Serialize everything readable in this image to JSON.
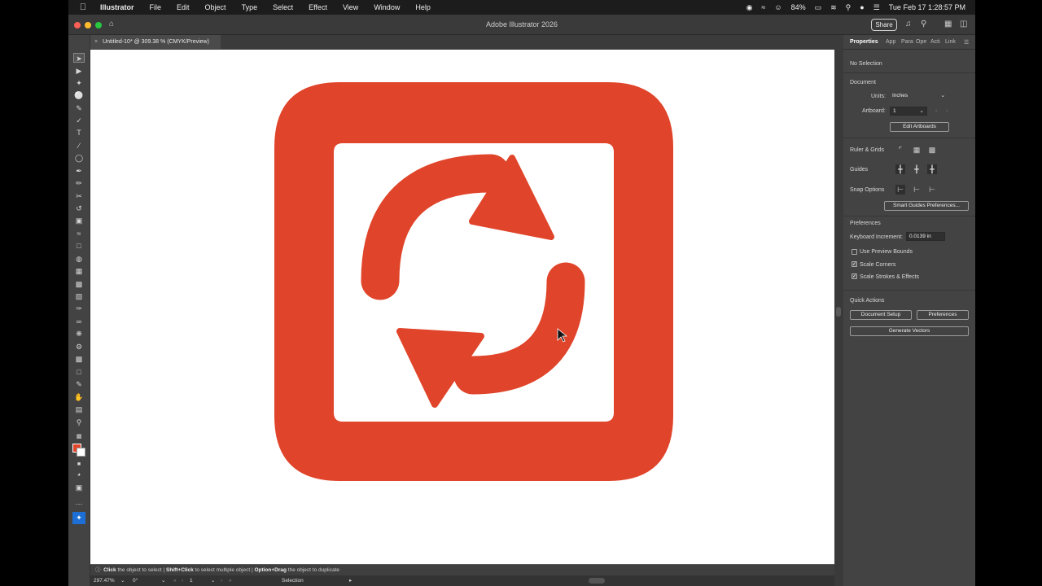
{
  "menubar": {
    "app": "Illustrator",
    "items": [
      "File",
      "Edit",
      "Object",
      "Type",
      "Select",
      "Effect",
      "View",
      "Window",
      "Help"
    ],
    "battery": "84%",
    "datetime": "Tue Feb 17  1:28:57 PM"
  },
  "window": {
    "title": "Adobe Illustrator 2026",
    "share_label": "Share"
  },
  "document_tab": {
    "label": "Untitled-10* @ 309.38 % (CMYK/Preview)"
  },
  "panel": {
    "tabs": [
      "Properties",
      "App",
      "Para",
      "Ope",
      "Acti",
      "Link"
    ],
    "selection": "No Selection",
    "document_heading": "Document",
    "units_label": "Units:",
    "units_value": "Inches",
    "artboard_label": "Artboard:",
    "artboard_value": "1",
    "edit_artboards": "Edit Artboards",
    "ruler_grids": "Ruler & Grids",
    "guides": "Guides",
    "snap_options": "Snap Options",
    "smart_guides_btn": "Smart Guides Preferences...",
    "preferences_heading": "Preferences",
    "keyboard_increment_label": "Keyboard Increment:",
    "keyboard_increment_value": "0.0139 in",
    "use_preview_bounds": "Use Preview Bounds",
    "scale_corners": "Scale Corners",
    "scale_strokes": "Scale Strokes & Effects",
    "quick_actions_heading": "Quick Actions",
    "document_setup_btn": "Document Setup",
    "preferences_btn": "Preferences",
    "generate_vectors_btn": "Generate Vectors"
  },
  "statusbar": {
    "click": "Click",
    "click_desc": " the object to select  |  ",
    "shift_click": "Shift+Click",
    "shift_desc": " to select multiple object  |  ",
    "option_drag": "Option+Drag",
    "option_desc": " the object to duplicate"
  },
  "bottombar": {
    "zoom": "297.47%",
    "rotation": "0°",
    "artboard_num": "1",
    "mode": "Selection"
  },
  "colors": {
    "icon_red": "#e0442a",
    "fill_swatch": "#e0442a"
  },
  "icons": {
    "artwork": "refresh-arrows-icon"
  }
}
